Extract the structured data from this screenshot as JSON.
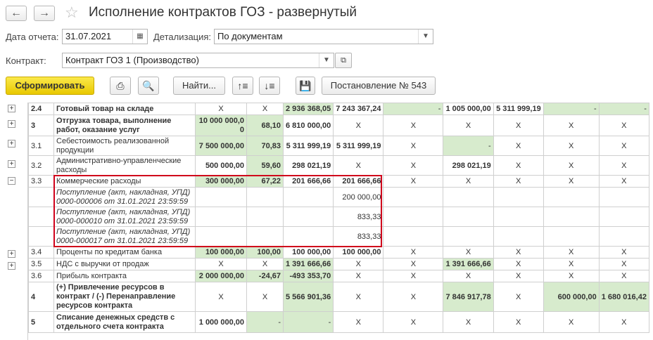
{
  "window": {
    "title": "Исполнение контрактов ГОЗ - развернутый",
    "back_icon": "←",
    "forward_icon": "→",
    "star_icon": "☆"
  },
  "filters": {
    "date_label": "Дата отчета:",
    "date_value": "31.07.2021",
    "detail_label": "Детализация:",
    "detail_value": "По документам",
    "contract_label": "Контракт:",
    "contract_value": "Контракт ГОЗ 1 (Производство)"
  },
  "toolbar": {
    "generate_label": "Сформировать",
    "find_label": "Найти...",
    "resolution_label": "Постановление № 543"
  },
  "colors": {
    "green_cell": "#d7ebcd",
    "highlight_border": "#d0021b",
    "primary_button": "#f5d90a"
  },
  "rows": [
    {
      "code": "2.4",
      "name": "Готовый товар на складе",
      "c": [
        "X",
        "X",
        "2 936 368,05",
        "7 243 367,24",
        "-",
        "1 005 000,00",
        "5 311 999,19",
        "-",
        "-"
      ]
    },
    {
      "code": "3",
      "name": "Отгрузка товара, выполнение работ, оказание услуг",
      "c": [
        "10 000 000,0 0",
        "68,10",
        "6 810 000,00",
        "X",
        "X",
        "X",
        "X",
        "X",
        "X"
      ]
    },
    {
      "code": "3.1",
      "name": "Себестоимость реализованной продукции",
      "c": [
        "7 500 000,00",
        "70,83",
        "5 311 999,19",
        "5 311 999,19",
        "X",
        "-",
        "X",
        "X",
        "X"
      ]
    },
    {
      "code": "3.2",
      "name": "Административно-управленческие расходы",
      "c": [
        "500 000,00",
        "59,60",
        "298 021,19",
        "X",
        "X",
        "298 021,19",
        "X",
        "X",
        "X"
      ]
    },
    {
      "code": "3.3",
      "name": "Коммерческие расходы",
      "c": [
        "300 000,00",
        "67,22",
        "201 666,66",
        "201 666,66",
        "X",
        "X",
        "X",
        "X",
        "X"
      ]
    },
    {
      "doc1": "Поступление (акт, накладная, УПД)",
      "doc2": "0000-000006 от 31.01.2021 23:59:59",
      "amount": "200 000,00"
    },
    {
      "doc1": "Поступление (акт, накладная, УПД)",
      "doc2": "0000-000010 от 31.01.2021 23:59:59",
      "amount": "833,33"
    },
    {
      "doc1": "Поступление (акт, накладная, УПД)",
      "doc2": "0000-000017 от 31.01.2021 23:59:59",
      "amount": "833,33"
    },
    {
      "code": "3.4",
      "name": "Проценты по кредитам банка",
      "c": [
        "100 000,00",
        "100,00",
        "100 000,00",
        "100 000,00",
        "X",
        "X",
        "X",
        "X",
        "X"
      ]
    },
    {
      "code": "3.5",
      "name": "НДС с выручки от продаж",
      "c": [
        "X",
        "X",
        "1 391 666,66",
        "X",
        "X",
        "1 391 666,66",
        "X",
        "X",
        "X"
      ]
    },
    {
      "code": "3.6",
      "name": "Прибыль контракта",
      "c": [
        "2 000 000,00",
        "-24,67",
        "-493 353,70",
        "X",
        "X",
        "X",
        "X",
        "X",
        "X"
      ]
    },
    {
      "code": "4",
      "name": "(+) Привлечение ресурсов в контракт / (-) Перенаправление ресурсов контракта",
      "c": [
        "X",
        "X",
        "5 566 901,36",
        "X",
        "X",
        "7 846 917,78",
        "X",
        "600 000,00",
        "1 680 016,42"
      ]
    },
    {
      "code": "5",
      "name": "Списание денежных средств с отдельного счета контракта",
      "c": [
        "1 000 000,00",
        "-",
        "-",
        "X",
        "X",
        "X",
        "X",
        "X",
        "X"
      ]
    }
  ]
}
